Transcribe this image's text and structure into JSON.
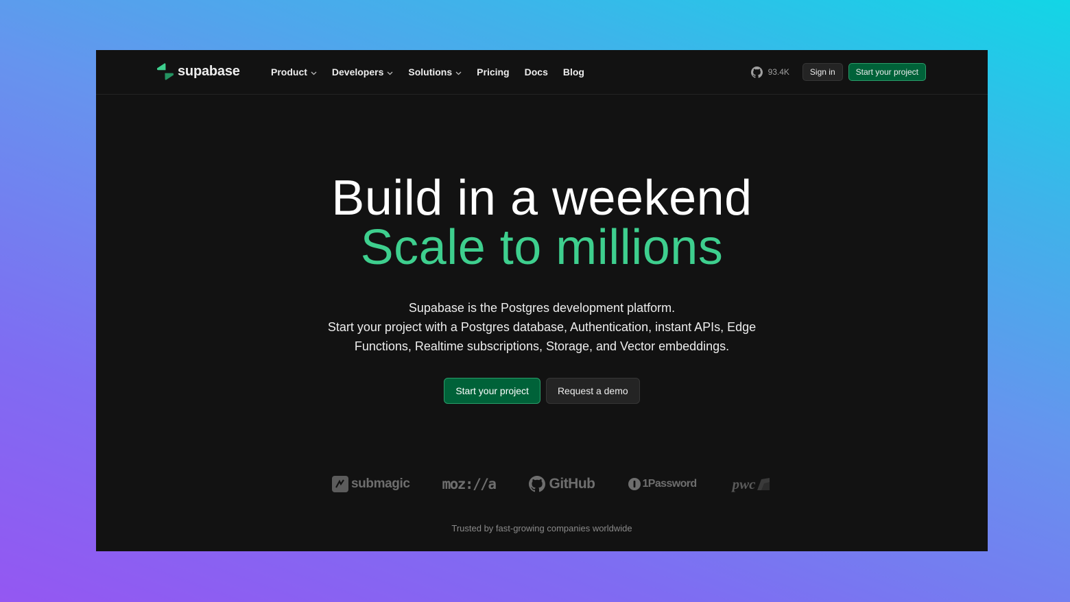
{
  "brand": {
    "name": "supabase",
    "accent_color": "#3ecf8e",
    "button_green": "#006239"
  },
  "nav": {
    "items": [
      {
        "label": "Product",
        "has_dropdown": true
      },
      {
        "label": "Developers",
        "has_dropdown": true
      },
      {
        "label": "Solutions",
        "has_dropdown": true
      },
      {
        "label": "Pricing",
        "has_dropdown": false
      },
      {
        "label": "Docs",
        "has_dropdown": false
      },
      {
        "label": "Blog",
        "has_dropdown": false
      }
    ],
    "github_stars": "93.4K",
    "sign_in_label": "Sign in",
    "start_label": "Start your project"
  },
  "hero": {
    "title_line1": "Build in a weekend",
    "title_line2": "Scale to millions",
    "subtitle_line1": "Supabase is the Postgres development platform.",
    "subtitle_line2": "Start your project with a Postgres database, Authentication, instant APIs, Edge",
    "subtitle_line3": "Functions, Realtime subscriptions, Storage, and Vector embeddings.",
    "primary_cta": "Start your project",
    "secondary_cta": "Request a demo"
  },
  "logos": {
    "items": [
      {
        "name": "submagic",
        "icon": "submagic-icon"
      },
      {
        "name": "moz://a",
        "icon": ""
      },
      {
        "name": "GitHub",
        "icon": "github-icon"
      },
      {
        "name": "1Password",
        "icon": "onepassword-icon"
      },
      {
        "name": "pwc",
        "icon": "pwc-icon"
      }
    ],
    "caption": "Trusted by fast-growing companies worldwide"
  }
}
